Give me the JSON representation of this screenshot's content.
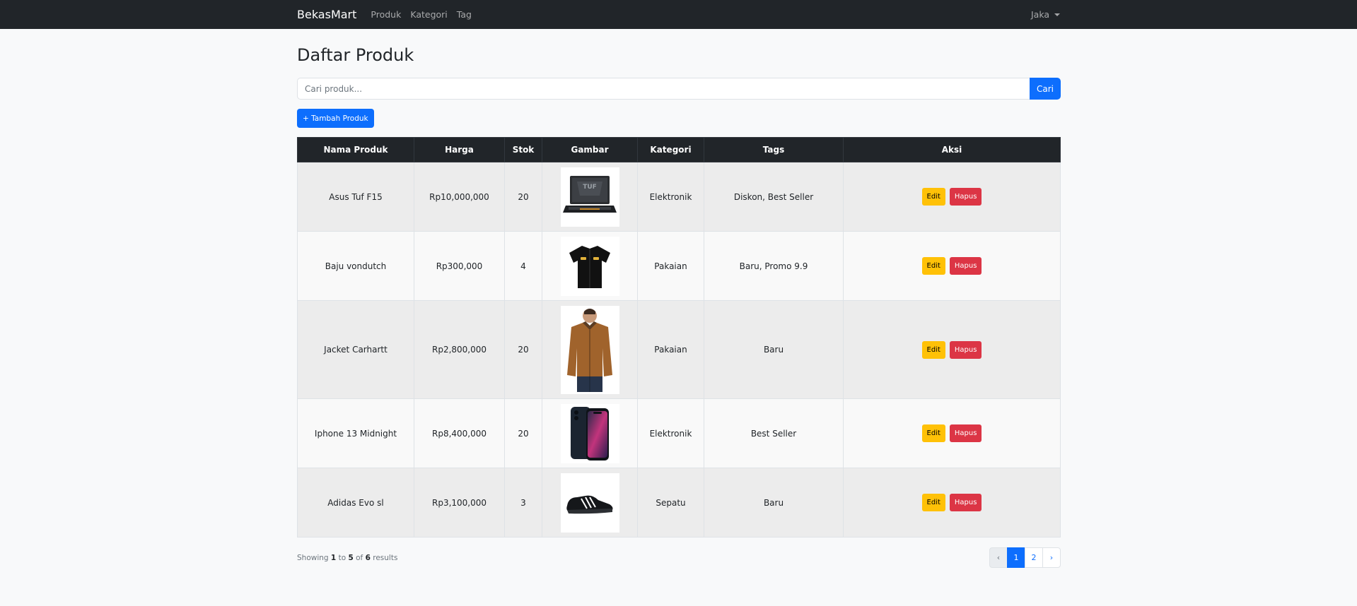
{
  "navbar": {
    "brand": "BekasMart",
    "links": [
      "Produk",
      "Kategori",
      "Tag"
    ],
    "user": "Jaka"
  },
  "page": {
    "title": "Daftar Produk"
  },
  "search": {
    "placeholder": "Cari produk...",
    "button": "Cari"
  },
  "add_button": "+ Tambah Produk",
  "table": {
    "headers": [
      "Nama Produk",
      "Harga",
      "Stok",
      "Gambar",
      "Kategori",
      "Tags",
      "Aksi"
    ],
    "rows": [
      {
        "name": "Asus Tuf F15",
        "price": "Rp10,000,000",
        "stock": "20",
        "image": "laptop-image",
        "category": "Elektronik",
        "tags": "Diskon, Best Seller"
      },
      {
        "name": "Baju vondutch",
        "price": "Rp300,000",
        "stock": "4",
        "image": "shirt-image",
        "category": "Pakaian",
        "tags": "Baru, Promo 9.9"
      },
      {
        "name": "Jacket Carhartt",
        "price": "Rp2,800,000",
        "stock": "20",
        "image": "jacket-image",
        "category": "Pakaian",
        "tags": "Baru"
      },
      {
        "name": "Iphone 13 Midnight",
        "price": "Rp8,400,000",
        "stock": "20",
        "image": "phone-image",
        "category": "Elektronik",
        "tags": "Best Seller"
      },
      {
        "name": "Adidas Evo sl",
        "price": "Rp3,100,000",
        "stock": "3",
        "image": "shoe-image",
        "category": "Sepatu",
        "tags": "Baru"
      }
    ],
    "edit_label": "Edit",
    "delete_label": "Hapus"
  },
  "pagination": {
    "showing_prefix": "Showing",
    "from": "1",
    "to_word": "to",
    "to": "5",
    "of_word": "of",
    "total": "6",
    "results_word": "results",
    "prev": "‹",
    "pages": [
      "1",
      "2"
    ],
    "next": "›"
  },
  "colors": {
    "navbar": "#212529",
    "primary": "#0d6efd",
    "warning": "#ffc107",
    "danger": "#dc3545"
  }
}
